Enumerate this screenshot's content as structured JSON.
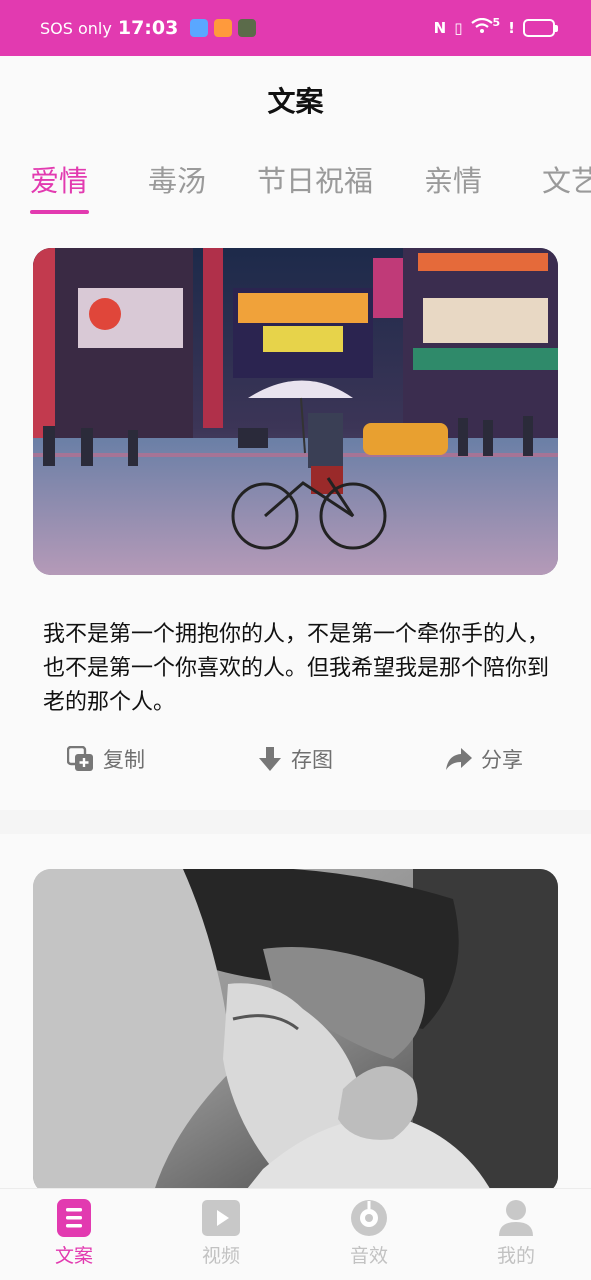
{
  "status_bar": {
    "carrier": "SOS only",
    "time": "17:03",
    "signal_text": "5"
  },
  "header": {
    "title": "文案"
  },
  "tabs": [
    {
      "label": "爱情",
      "active": true
    },
    {
      "label": "毒汤",
      "active": false
    },
    {
      "label": "节日祝福",
      "active": false
    },
    {
      "label": "亲情",
      "active": false
    },
    {
      "label": "文艺",
      "active": false
    }
  ],
  "cards": [
    {
      "image": "night-city-cyclist-photo",
      "text": "我不是第一个拥抱你的人，不是第一个牵你手的人，也不是第一个你喜欢的人。但我希望我是那个陪你到老的那个人。",
      "actions": {
        "copy": "复制",
        "save": "存图",
        "share": "分享"
      }
    },
    {
      "image": "couple-kiss-bw-photo"
    }
  ],
  "bottom_nav": [
    {
      "label": "文案",
      "icon": "document-icon",
      "active": true
    },
    {
      "label": "视频",
      "icon": "video-icon",
      "active": false
    },
    {
      "label": "音效",
      "icon": "music-icon",
      "active": false
    },
    {
      "label": "我的",
      "icon": "profile-icon",
      "active": false
    }
  ],
  "colors": {
    "accent": "#e23ab0",
    "inactive": "#9a9a9a",
    "nav_inactive": "#c2c2c2"
  }
}
